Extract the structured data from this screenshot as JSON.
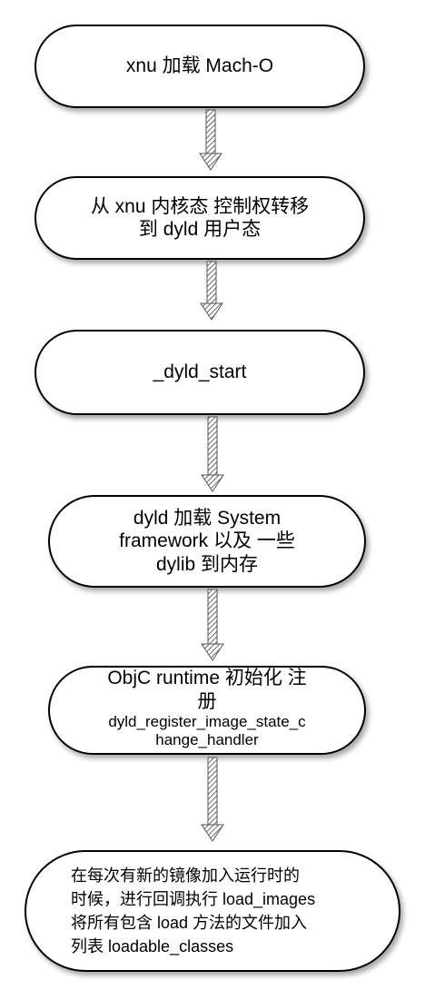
{
  "nodes": [
    {
      "id": "load-macho",
      "lines": [
        "xnu 加载 Mach-O"
      ]
    },
    {
      "id": "kernel-to-user",
      "lines": [
        "从 xnu 内核态 控制权转移",
        "到 dyld 用户态"
      ]
    },
    {
      "id": "dyld-start",
      "lines": [
        "_dyld_start"
      ]
    },
    {
      "id": "load-frameworks",
      "lines": [
        "dyld 加载 System",
        "framework 以及 一些",
        "dylib 到内存"
      ]
    },
    {
      "id": "objc-runtime",
      "lines": [
        "ObjC runtime 初始化 注",
        "册"
      ],
      "sub_lines": [
        "dyld_register_image_state_c",
        "hange_handler"
      ]
    },
    {
      "id": "load-images",
      "lines": [
        "在每次有新的镜像加入运行时的",
        "时候，进行回调执行 load_images",
        "将所有包含 load 方法的文件加入",
        "列表 loadable_classes"
      ]
    }
  ],
  "colors": {
    "stroke": "#000000",
    "fill": "#ffffff",
    "shadow": "#9a9a9a",
    "arrow": "#555555"
  }
}
